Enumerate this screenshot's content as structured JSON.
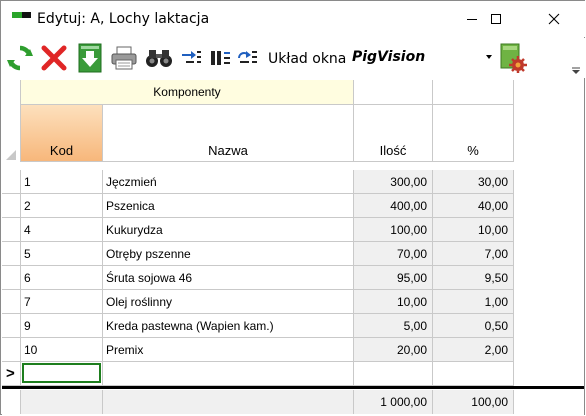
{
  "window": {
    "title": "Edytuj: A, Lochy laktacja",
    "controls": [
      "minimize",
      "maximize",
      "close"
    ]
  },
  "toolbar": {
    "icons": [
      "refresh-icon",
      "delete-icon",
      "download-icon",
      "print-icon",
      "find-icon",
      "move-icon",
      "arrange-icon",
      "swap-icon",
      "settings-icon"
    ],
    "layout_label": "Układ okna",
    "layout_value": "PigVision"
  },
  "grid": {
    "group_header": "Komponenty",
    "columns": [
      "Kod",
      "Nazwa",
      "Ilość",
      "%"
    ],
    "rows": [
      {
        "kod": "1",
        "nazwa": "Jęczmień",
        "ilosc": "300,00",
        "pct": "30,00"
      },
      {
        "kod": "2",
        "nazwa": "Pszenica",
        "ilosc": "400,00",
        "pct": "40,00"
      },
      {
        "kod": "4",
        "nazwa": "Kukurydza",
        "ilosc": "100,00",
        "pct": "10,00"
      },
      {
        "kod": "5",
        "nazwa": "Otręby pszenne",
        "ilosc": "70,00",
        "pct": "7,00"
      },
      {
        "kod": "6",
        "nazwa": "Śruta sojowa 46",
        "ilosc": "95,00",
        "pct": "9,50"
      },
      {
        "kod": "7",
        "nazwa": "Olej roślinny",
        "ilosc": "10,00",
        "pct": "1,00"
      },
      {
        "kod": "9",
        "nazwa": "Kreda pastewna (Wapien kam.)",
        "ilosc": "5,00",
        "pct": "0,50"
      },
      {
        "kod": "10",
        "nazwa": "Premix",
        "ilosc": "20,00",
        "pct": "2,00"
      }
    ],
    "new_row_marker": ">",
    "totals": {
      "ilosc": "1 000,00",
      "pct": "100,00"
    }
  }
}
